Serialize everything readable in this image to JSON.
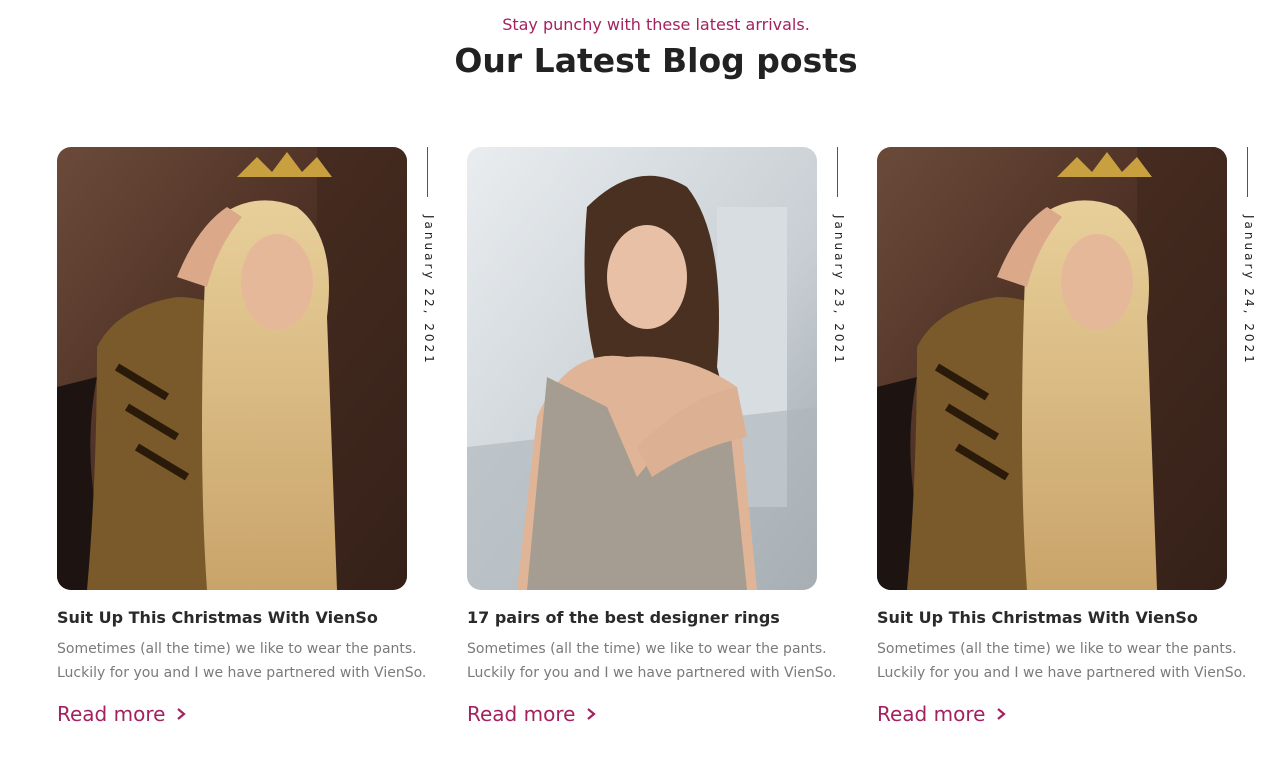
{
  "header": {
    "subtitle": "Stay punchy with these latest arrivals.",
    "title": "Our Latest Blog posts"
  },
  "posts": [
    {
      "date": "January 22, 2021",
      "title": "Suit Up This Christmas With VienSo",
      "excerpt": "Sometimes (all the time) we like to wear the pants. Luckily for you and I we have partnered with VienSo.",
      "read_more": "Read more"
    },
    {
      "date": "January 23, 2021",
      "title": "17 pairs of the best designer rings",
      "excerpt": "Sometimes (all the time) we like to wear the pants. Luckily for you and I we have partnered with VienSo.",
      "read_more": "Read more"
    },
    {
      "date": "January 24, 2021",
      "title": "Suit Up This Christmas With VienSo",
      "excerpt": "Sometimes (all the time) we like to wear the pants. Luckily for you and I we have partnered with VienSo.",
      "read_more": "Read more"
    }
  ],
  "colors": {
    "accent": "#a4215f",
    "heading": "#222222",
    "body_text": "#7a7a7a"
  },
  "icons": {
    "read_more": "chevron-right-icon"
  }
}
